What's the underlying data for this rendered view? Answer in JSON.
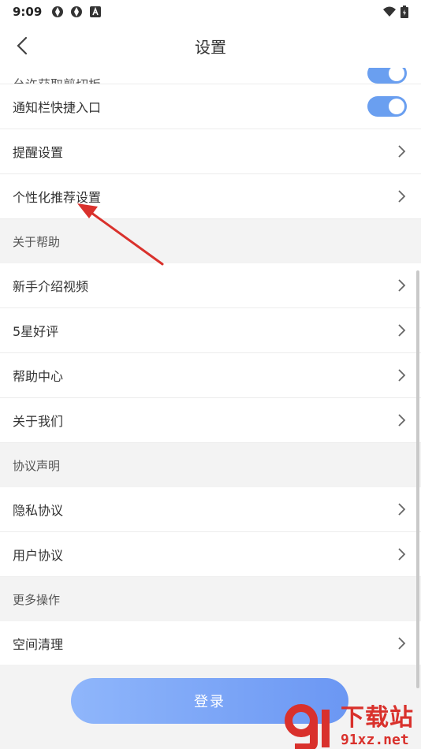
{
  "status_bar": {
    "time": "9:09",
    "left_icons": [
      "app-icon",
      "app-icon",
      "a-icon"
    ],
    "right_icons": [
      "wifi-icon",
      "battery-icon"
    ]
  },
  "header": {
    "title": "设置",
    "back_icon": "chevron-left-icon"
  },
  "settings": {
    "rows_top": [
      {
        "label": "允许获取剪切板",
        "control": "toggle",
        "on": true
      },
      {
        "label": "通知栏快捷入口",
        "control": "toggle",
        "on": true
      },
      {
        "label": "提醒设置",
        "control": "chevron"
      },
      {
        "label": "个性化推荐设置",
        "control": "chevron"
      }
    ],
    "sections": [
      {
        "title": "关于帮助",
        "items": [
          "新手介绍视频",
          "5星好评",
          "帮助中心",
          "关于我们"
        ]
      },
      {
        "title": "协议声明",
        "items": [
          "隐私协议",
          "用户协议"
        ]
      },
      {
        "title": "更多操作",
        "items": [
          "空间清理"
        ]
      }
    ]
  },
  "login_button": {
    "label": "登录"
  },
  "watermark": {
    "cn": "下载站",
    "url": "91xz.net"
  },
  "colors": {
    "accent": "#6a9ff0",
    "watermark": "#d9312c",
    "annotation_arrow": "#d9312c"
  }
}
